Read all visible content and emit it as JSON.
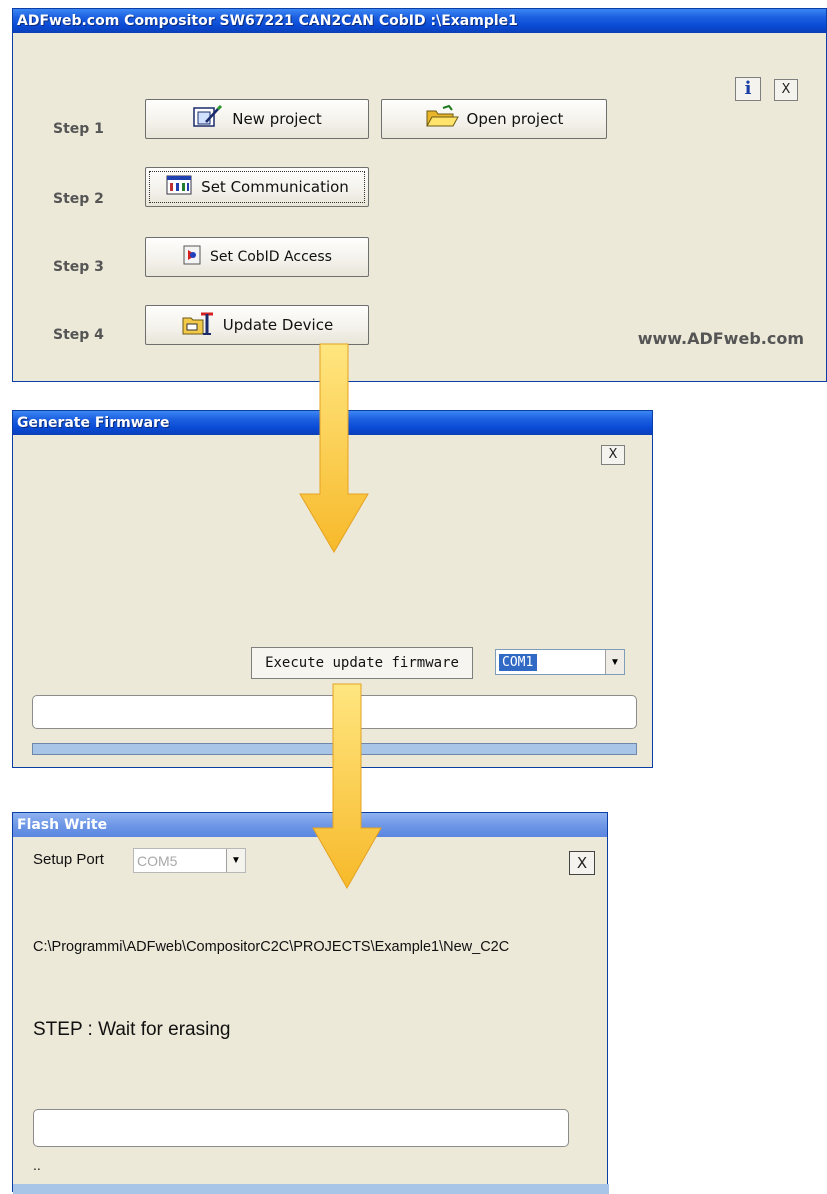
{
  "window1": {
    "title": "ADFweb.com Compositor SW67221 CAN2CAN CobID :\\Example1",
    "info_icon": "info-icon",
    "close_label": "X",
    "steps": [
      {
        "label": "Step 1"
      },
      {
        "label": "Step 2"
      },
      {
        "label": "Step 3"
      },
      {
        "label": "Step 4"
      }
    ],
    "buttons": {
      "new_project": "New project",
      "open_project": "Open project",
      "set_communication": "Set Communication",
      "set_cobid_access": "Set CobID Access",
      "update_device": "Update Device"
    },
    "website": "www.ADFweb.com"
  },
  "window2": {
    "title": "Generate Firmware",
    "close_label": "X",
    "execute_button": "Execute update firmware",
    "port_select": {
      "value": "COM1"
    },
    "status_text": "",
    "progress": 0
  },
  "window3": {
    "title": "Flash Write",
    "close_label": "X",
    "setup_port_label": "Setup Port",
    "port_select": {
      "value": "COM5"
    },
    "file_path": "C:\\Programmi\\ADFweb\\CompositorC2C\\PROJECTS\\Example1\\New_C2C",
    "step_text": "STEP : Wait for erasing",
    "status_text": "",
    "footer_text": ".."
  },
  "colors": {
    "titlebar": "#0a4bd6",
    "window_bg": "#ece9d8",
    "arrow": "#f7b92a",
    "progress": "#a8c4e6",
    "selection": "#316ac5"
  }
}
